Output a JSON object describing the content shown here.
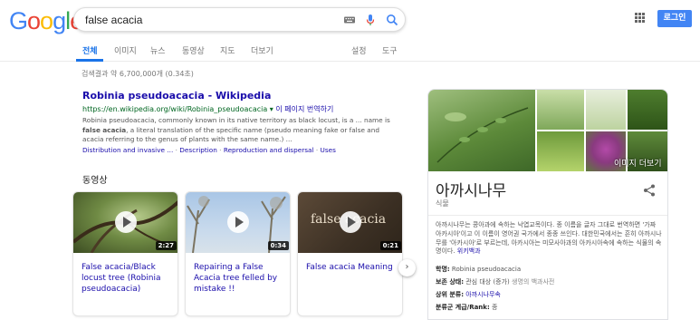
{
  "logo": {
    "text": "Google",
    "letters": [
      "G",
      "o",
      "o",
      "g",
      "l",
      "e"
    ],
    "colors": [
      "#4285f4",
      "#ea4335",
      "#fbbc05",
      "#4285f4",
      "#34a853",
      "#ea4335"
    ]
  },
  "search": {
    "query": "false acacia"
  },
  "header": {
    "login_label": "로그인"
  },
  "tabs": [
    {
      "label": "전체",
      "active": true
    },
    {
      "label": "이미지"
    },
    {
      "label": "뉴스"
    },
    {
      "label": "동영상"
    },
    {
      "label": "지도"
    },
    {
      "label": "더보기"
    }
  ],
  "tools": {
    "settings": "설정",
    "tools": "도구"
  },
  "stats": "검색결과 약 6,700,000개 (0.34초)",
  "result": {
    "title": "Robinia pseudoacacia - Wikipedia",
    "url": "https://en.wikipedia.org/wiki/Robinia_pseudoacacia",
    "url_arrow": "▾",
    "translate": "이 페이지 번역하기",
    "snippet_1": "Robinia pseudoacacia, commonly known in its native territory as black locust, is a ... name is ",
    "snippet_b1": "false",
    "snippet_2": "",
    "snippet_b2": "acacia",
    "snippet_3": ", a literal translation of the specific name (pseudo meaning fake or false and acacia referring to the genus of plants with the same name.) ...",
    "links": [
      "Distribution and invasive ...",
      "Description",
      "Reproduction and dispersal",
      "Uses"
    ],
    "link_sep": "·"
  },
  "videos": {
    "heading": "동영상",
    "items": [
      {
        "title": "False acacia/Black locust tree (Robinia pseudoacacia)",
        "duration": "2:27",
        "overlay": ""
      },
      {
        "title": "Repairing a False Acacia tree felled by mistake !!",
        "duration": "0:34",
        "overlay": ""
      },
      {
        "title": "False acacia Meaning",
        "duration": "0:21",
        "overlay": "false acacia"
      }
    ],
    "next_arrow": "›"
  },
  "knowledge_panel": {
    "more_images": "이미지 더보기",
    "title": "아까시나무",
    "subtitle": "식물",
    "description": "아까시나무는 콩아과에 속하는 낙엽교목이다. 종 이름을 글자 그대로 번역하면 '가짜 아카시아'이고 이 이름이 영어권 국가에서 종종 쓰인다. 대한민국에서는 흔히 아까시나무를 '아카시아'로 부르는데, 아카시아는 미모사아과의 아카시아속에 속하는 식물의 속명이다. ",
    "wiki_link": "위키백과",
    "facts": [
      {
        "label": "학명:",
        "value": "Robinia pseudoacacia",
        "note": ""
      },
      {
        "label": "보존 상태:",
        "value": "관심 대상 (증가)",
        "note": " 생명의 백과사전"
      },
      {
        "label": "상위 분류:",
        "value": "아까시나무속",
        "note": "",
        "link": true
      },
      {
        "label": "분류군 계급/Rank:",
        "value": "종",
        "note": ""
      }
    ]
  }
}
